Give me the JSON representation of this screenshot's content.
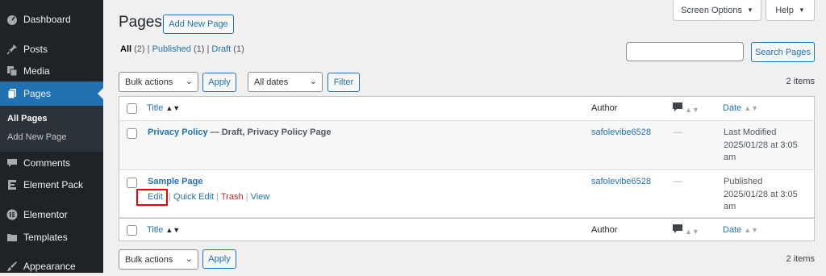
{
  "sidebar": {
    "items": [
      {
        "label": "Dashboard",
        "icon": "dashboard-icon"
      },
      {
        "label": "Posts",
        "icon": "pin-icon"
      },
      {
        "label": "Media",
        "icon": "media-icon"
      },
      {
        "label": "Pages",
        "icon": "pages-icon"
      },
      {
        "label": "Comments",
        "icon": "comments-icon"
      },
      {
        "label": "Element Pack",
        "icon": "element-pack-icon"
      },
      {
        "label": "Elementor",
        "icon": "elementor-icon"
      },
      {
        "label": "Templates",
        "icon": "folder-icon"
      },
      {
        "label": "Appearance",
        "icon": "brush-icon"
      }
    ],
    "submenu": [
      "All Pages",
      "Add New Page"
    ]
  },
  "header": {
    "title": "Pages",
    "add_new": "Add New Page",
    "screen_options": "Screen Options",
    "help": "Help"
  },
  "views": {
    "all": "All",
    "all_count": "(2)",
    "published": "Published",
    "published_count": "(1)",
    "draft": "Draft",
    "draft_count": "(1)"
  },
  "search": {
    "button": "Search Pages",
    "value": ""
  },
  "tablenav": {
    "bulk_actions": "Bulk actions",
    "apply": "Apply",
    "all_dates": "All dates",
    "filter": "Filter",
    "count": "2 items"
  },
  "table": {
    "columns": {
      "title": "Title",
      "author": "Author",
      "date": "Date"
    },
    "rows": [
      {
        "title": "Privacy Policy",
        "state": " — Draft, Privacy Policy Page",
        "author": "safolevibe6528",
        "comments": "—",
        "date_status": "Last Modified",
        "date_value": "2025/01/28 at 3:05",
        "date_ampm": "am"
      },
      {
        "title": "Sample Page",
        "state": "",
        "author": "safolevibe6528",
        "comments": "—",
        "date_status": "Published",
        "date_value": "2025/01/28 at 3:05",
        "date_ampm": "am"
      }
    ],
    "row_actions": {
      "edit": "Edit",
      "quick_edit": "Quick Edit",
      "trash": "Trash",
      "view": "View"
    }
  },
  "colors": {
    "accent": "#2271b1",
    "sidebar": "#1d2327",
    "highlight": "#e00000"
  }
}
